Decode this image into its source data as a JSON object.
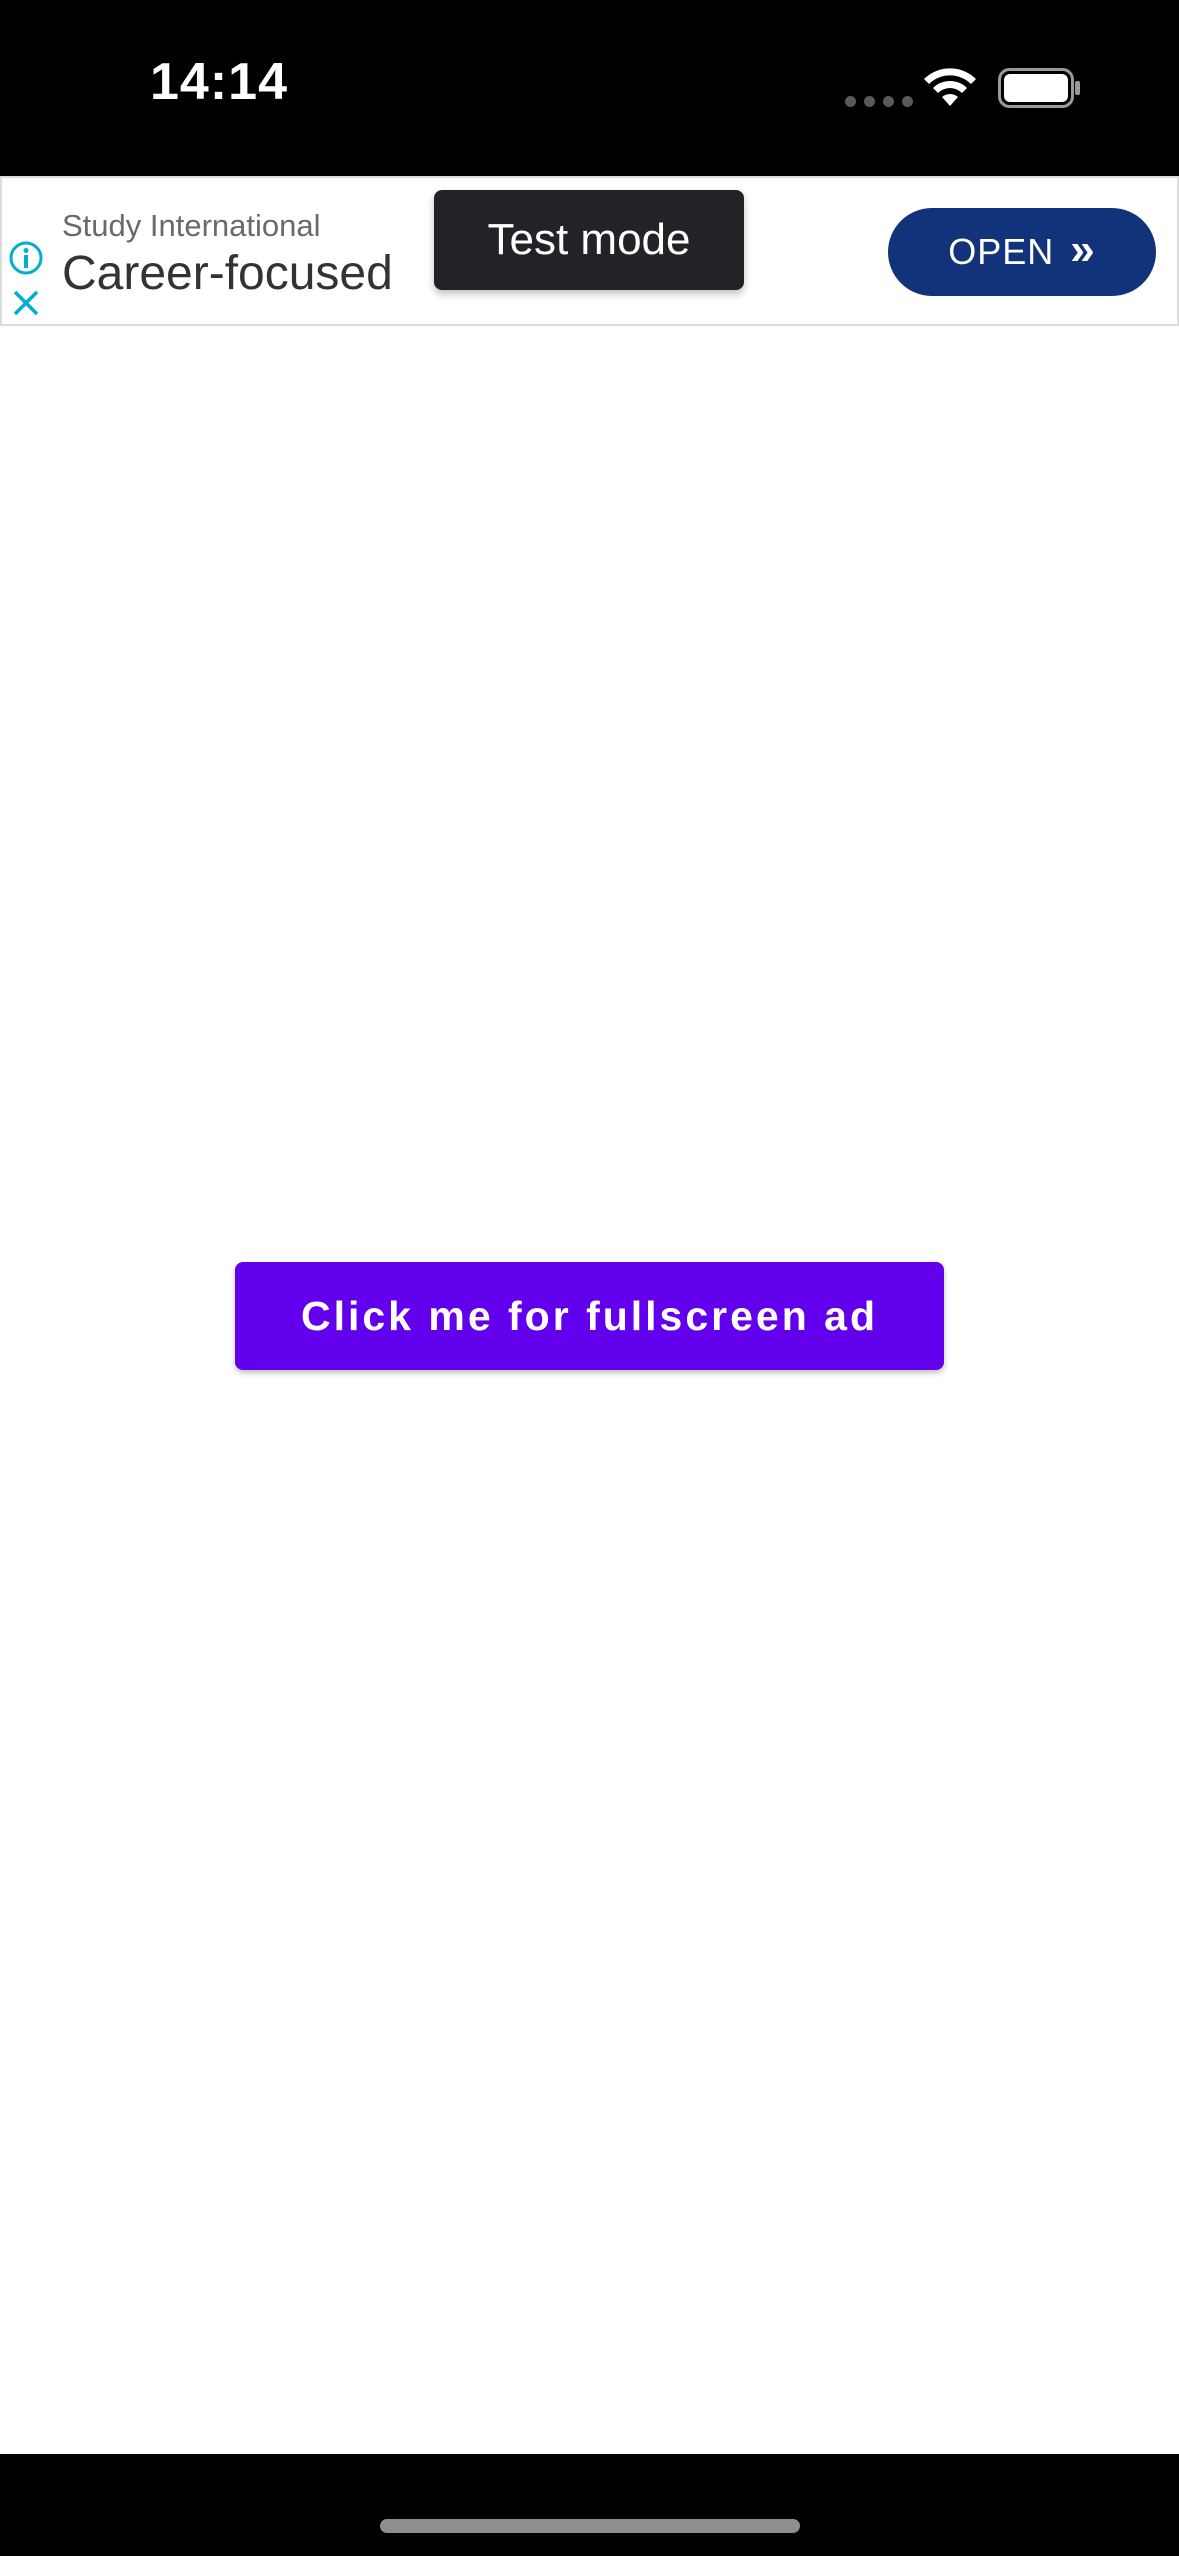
{
  "status_bar": {
    "time": "14:14",
    "icons": [
      "cellular-icon",
      "wifi-icon",
      "battery-icon"
    ]
  },
  "ad_banner": {
    "advertiser": "Study International",
    "headline": "Career-focused",
    "cta_label": "OPEN",
    "cta_chevrons": "»",
    "test_mode_label": "Test mode",
    "colors": {
      "cta_background": "#12327a",
      "info_icon": "#00aecd",
      "test_badge": "#222326"
    }
  },
  "main": {
    "fullscreen_button_label": "Click me for fullscreen ad",
    "colors": {
      "button_background": "#6200ee"
    }
  }
}
